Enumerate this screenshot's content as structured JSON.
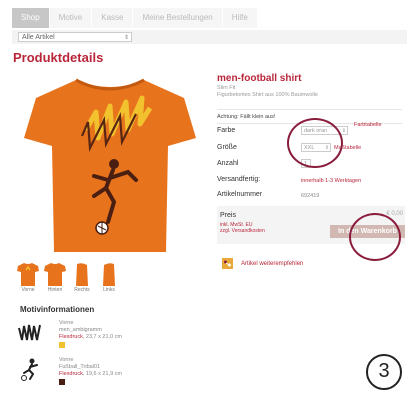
{
  "tabs": [
    "Shop",
    "Motive",
    "Kasse",
    "Meine Bestellungen",
    "Hilfe"
  ],
  "filter": {
    "selected": "Alle Artikel"
  },
  "heading": "Produktdetails",
  "product": {
    "name": "men-football shirt",
    "fit": "Slim Fit",
    "desc": "Figurbetontes Shirt aus 100% Baumwolle",
    "warning": "Achtung: Fällt klein aus!"
  },
  "details": {
    "farbe_label": "Farbe",
    "farbe_value": "dark oran",
    "farbtabelle": "Farbtabelle",
    "groesse_label": "Größe",
    "groesse_value": "XXL",
    "masstabelle": "Maßtabelle",
    "anzahl_label": "Anzahl",
    "anzahl_value": "1",
    "versand_label": "Versandfertig:",
    "versand_value": "innerhalb 1-3 Werktagen",
    "artikel_label": "Artikelnummer",
    "artikel_value": "692419"
  },
  "price": {
    "label": "Preis",
    "value": "€ 0,00",
    "info1": "inkl. MwSt. EU",
    "info2": "zzgl. Versandkosten",
    "cart_button": "In den Warenkorb"
  },
  "recommend": "Artikel weiterempfehlen",
  "thumbnails": [
    "Vorne",
    "Hinten",
    "Rechts",
    "Links"
  ],
  "motiv": {
    "title": "Motivinformationen",
    "items": [
      {
        "side": "Vorne",
        "name": "men_ambigramm",
        "print": "Flexdruck",
        "size": "23,7 x 21,0 cm",
        "color": "#f2c12e"
      },
      {
        "side": "Vorne",
        "name": "Fußball_Tribal01",
        "print": "Flexdruck",
        "size": "19,6 x 21,9 cm",
        "color": "#4a1f12"
      }
    ]
  },
  "step_number": "3",
  "colors": {
    "accent": "#b9263a",
    "shirt": "#e8731d",
    "annotation": "#8a1c3c"
  }
}
